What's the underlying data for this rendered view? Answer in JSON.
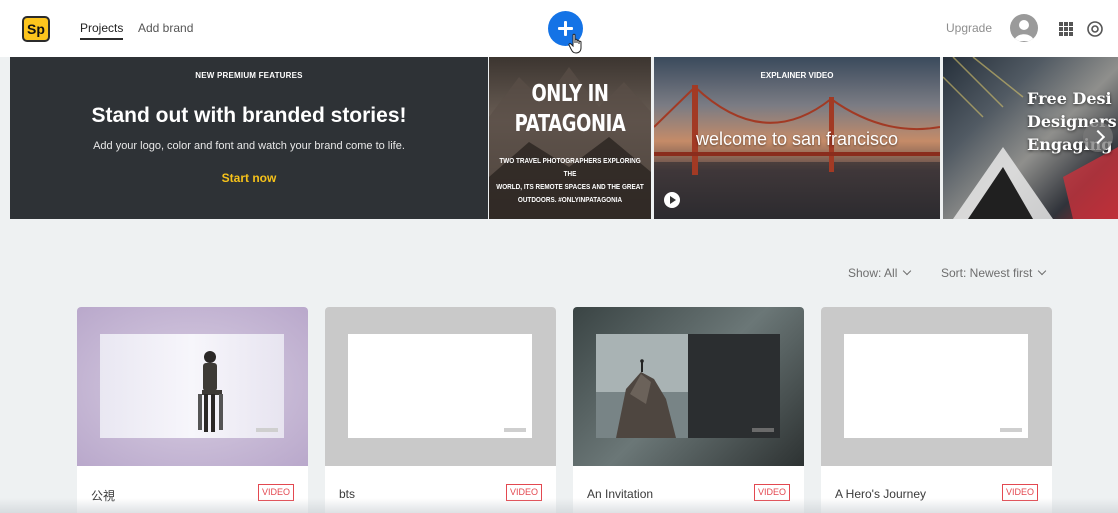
{
  "app": {
    "logo_text": "Sp",
    "brand_color": "#fdc51d",
    "accent_color": "#1473e6"
  },
  "nav": {
    "tabs": [
      {
        "label": "Projects",
        "active": true
      },
      {
        "label": "Add brand",
        "active": false
      }
    ],
    "create_icon": "plus-icon",
    "upgrade_label": "Upgrade",
    "icons": [
      "avatar-icon",
      "apps-grid-icon",
      "creative-cloud-icon"
    ]
  },
  "banner": {
    "kicker": "NEW PREMIUM FEATURES",
    "title": "Stand out with branded stories!",
    "subtitle": "Add your logo, color and font and watch your brand come to life.",
    "cta": "Start now"
  },
  "carousel": [
    {
      "title_line1": "ONLY IN",
      "title_line2": "PATAGONIA",
      "sub_line1": "TWO TRAVEL PHOTOGRAPHERS EXPLORING THE",
      "sub_line2": "WORLD, ITS REMOTE SPACES AND THE GREAT",
      "sub_line3": "OUTDOORS. #ONLYINPATAGONIA"
    },
    {
      "kicker": "EXPLAINER VIDEO",
      "title": "welcome to san francisco",
      "icon": "play-icon"
    },
    {
      "title_line1": "Free Desi",
      "title_line2": "Designers",
      "title_line3": "Engaging"
    }
  ],
  "filters": {
    "show": "Show: All",
    "sort": "Sort: Newest first"
  },
  "projects": [
    {
      "title": "公視",
      "badge": "VIDEO"
    },
    {
      "title": "bts",
      "badge": "VIDEO"
    },
    {
      "title": "An Invitation",
      "badge": "VIDEO"
    },
    {
      "title": "A Hero's Journey",
      "badge": "VIDEO"
    }
  ]
}
